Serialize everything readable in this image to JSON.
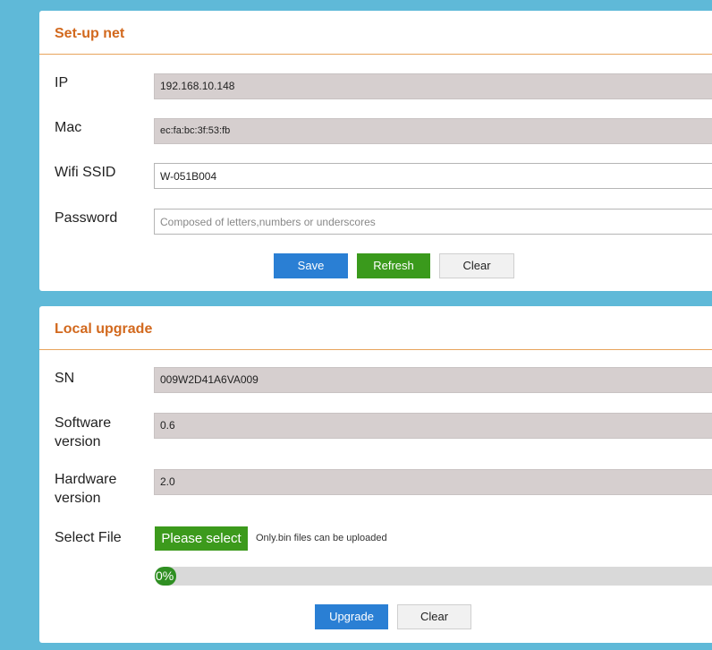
{
  "setup_net": {
    "title": "Set-up net",
    "ip": {
      "label": "IP",
      "value": "192.168.10.148"
    },
    "mac": {
      "label": "Mac",
      "value": "ec:fa:bc:3f:53:fb"
    },
    "ssid": {
      "label": "Wifi SSID",
      "value": "W-051B004"
    },
    "password": {
      "label": "Password",
      "value": "",
      "placeholder": "Composed of letters,numbers or underscores"
    },
    "buttons": {
      "save": "Save",
      "refresh": "Refresh",
      "clear": "Clear"
    }
  },
  "local_upgrade": {
    "title": "Local upgrade",
    "sn": {
      "label": "SN",
      "value": "009W2D41A6VA009"
    },
    "software": {
      "label_line1": "Software",
      "label_line2": "version",
      "value": "0.6"
    },
    "hardware": {
      "label_line1": "Hardware",
      "label_line2": "version",
      "value": "2.0"
    },
    "select_file": {
      "label": "Select File",
      "button": "Please select",
      "hint": "Only.bin files can be uploaded"
    },
    "progress": {
      "text": "0%",
      "value": 0
    },
    "buttons": {
      "upgrade": "Upgrade",
      "clear": "Clear"
    }
  },
  "colors": {
    "background": "#5fb9d8",
    "title": "#d2691e",
    "primary": "#2a7fd4",
    "success": "#3a9a1c"
  }
}
